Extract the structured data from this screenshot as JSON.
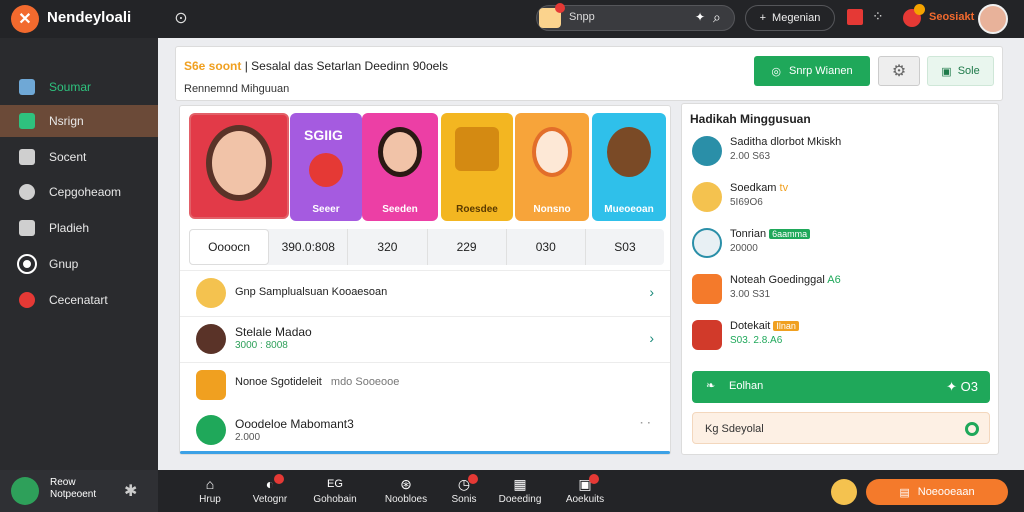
{
  "topbar": {
    "app_title": "Nendeyloali",
    "search_placeholder": "Snpp",
    "pill_label": "Megenian",
    "user_name": "Seosiakt"
  },
  "sidebar": {
    "items": [
      {
        "label": "Soumar",
        "icon": "users-icon",
        "active": false,
        "green": true
      },
      {
        "label": "Nsrign",
        "icon": "clover-icon",
        "active": true,
        "green": false
      },
      {
        "label": "Socent",
        "icon": "chat-icon",
        "active": false,
        "green": false
      },
      {
        "label": "Cepgoheaom",
        "icon": "speech-icon",
        "active": false,
        "green": false
      },
      {
        "label": "Pladieh",
        "icon": "tablet-icon",
        "active": false,
        "green": false
      },
      {
        "label": "Gnup",
        "icon": "circle-icon",
        "active": false,
        "green": false
      },
      {
        "label": "Cecenatart",
        "icon": "ban-icon",
        "active": false,
        "green": false
      }
    ]
  },
  "header": {
    "title_highlight": "S6e soont",
    "title_text": "Sesalal das Setarlan Deedinn 90oels",
    "subtitle": "Rennemnd Mihguuan",
    "btn_primary": "Snrp Wianen",
    "btn_secondary": "Sole"
  },
  "characters": {
    "tiles": [
      {
        "label": ""
      },
      {
        "label": "Seeer"
      },
      {
        "label": "Seeden"
      },
      {
        "label": "Roesdee"
      },
      {
        "label": "Nonsno"
      },
      {
        "label": "Mueoeoan"
      }
    ],
    "tile_banner": "SGIIG"
  },
  "stats": [
    "Oooocn",
    "390.0:808",
    "320",
    "229",
    "030",
    "S03"
  ],
  "list": [
    {
      "primary": "Gnp Samplualsuan Kooaesoan",
      "secondary": ""
    },
    {
      "primary": "Stelale Madao",
      "secondary": "3000 : 8008"
    },
    {
      "primary": "Nonoe Sgotideleit",
      "muted": "mdo Sooeooe",
      "secondary": ""
    },
    {
      "primary": "Ooodeloe Mabomant3",
      "secondary": "2.000"
    }
  ],
  "right_panel": {
    "title": "Hadikah Minggusuan",
    "items": [
      {
        "name": "Saditha dlorbot Mkiskh",
        "meta": "2.00 S63",
        "tag": ""
      },
      {
        "name": "Soedkam",
        "meta": "5I69O6",
        "tag": "tv"
      },
      {
        "name": "Tonrian",
        "meta": "20000",
        "tag": "6aamma"
      },
      {
        "name": "Noteah Goedinggal",
        "meta": "3.00 S31",
        "tag": "A6"
      },
      {
        "name": "Dotekait",
        "meta": "S03. 2.8.A6",
        "tag": "Ilnan"
      }
    ],
    "btn_primary": "Eolhan",
    "btn_right": "O3",
    "input_label": "Kg Sdeyolal"
  },
  "bottombar": {
    "user_name": "Reow",
    "user_sub": "Notpeoent",
    "nav": [
      {
        "label": "Hrup",
        "badge": false
      },
      {
        "label": "Vetognr",
        "badge": true
      },
      {
        "label": "Gohobain",
        "badge": false
      },
      {
        "label": "Noobloes",
        "badge": true
      },
      {
        "label": "Sonis",
        "badge": true
      },
      {
        "label": "Doeeding",
        "badge": false
      },
      {
        "label": "Aoekuits",
        "badge": true
      }
    ],
    "orange_btn": "Noeooeaan"
  }
}
